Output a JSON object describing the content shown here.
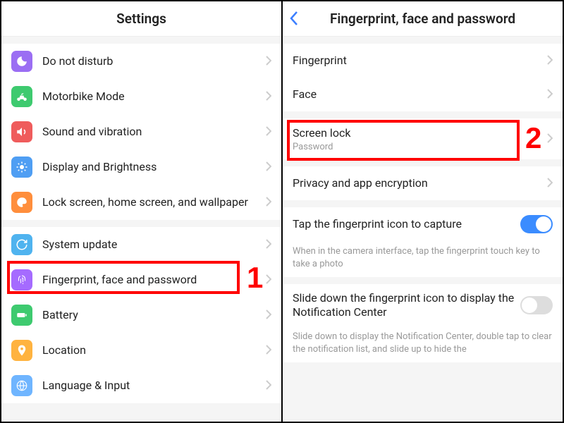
{
  "left": {
    "title": "Settings",
    "groups": [
      [
        "Do not disturb",
        "Motorbike Mode",
        "Sound and vibration",
        "Display and Brightness",
        "Lock screen, home screen, and wallpaper"
      ],
      [
        "System update",
        "Fingerprint, face and password",
        "Battery",
        "Location",
        "Language & Input"
      ]
    ]
  },
  "right": {
    "title": "Fingerprint, face and password",
    "group1": [
      "Fingerprint",
      "Face"
    ],
    "screenlock": {
      "label": "Screen lock",
      "value": "Password"
    },
    "privacy": "Privacy and app encryption",
    "tap": {
      "label": "Tap the fingerprint icon to capture",
      "help": "When in the camera interface, tap the fingerprint touch key to take a photo"
    },
    "slide": {
      "label": "Slide down the fingerprint icon to display the Notification Center",
      "help": "Slide down to display the Notification Center, double tap to clear the notification list, and slide up to hide the"
    }
  },
  "marker1": "1",
  "marker2": "2"
}
